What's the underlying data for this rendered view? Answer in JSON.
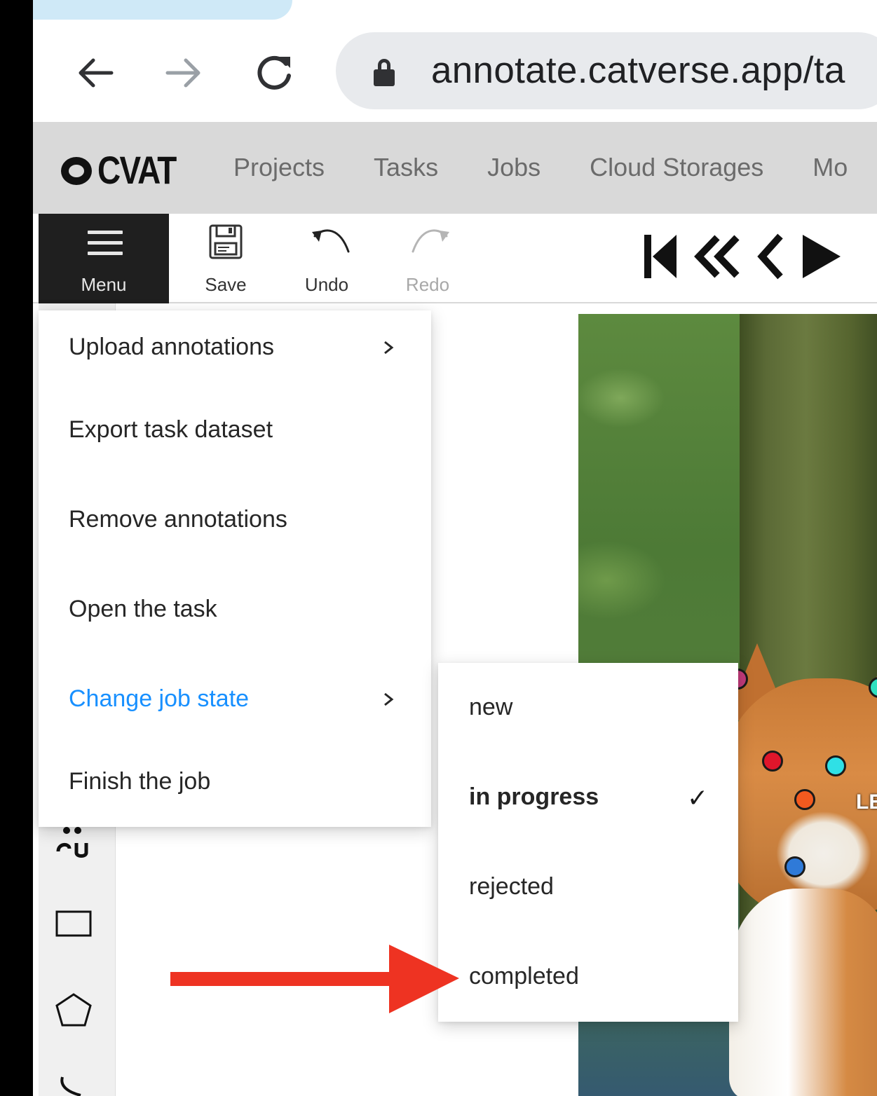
{
  "browser": {
    "back_icon": "arrow-left-icon",
    "forward_icon": "arrow-right-icon",
    "reload_icon": "reload-icon",
    "lock_icon": "lock-icon",
    "url": "annotate.catverse.app/ta"
  },
  "app_header": {
    "logo_text": "CVAT",
    "nav": [
      "Projects",
      "Tasks",
      "Jobs",
      "Cloud Storages",
      "Mo"
    ]
  },
  "toolbar": {
    "menu_label": "Menu",
    "save_label": "Save",
    "undo_label": "Undo",
    "redo_label": "Redo",
    "player_icons": [
      "first-frame-icon",
      "fast-backward-icon",
      "previous-icon",
      "play-icon"
    ]
  },
  "main_menu": {
    "items": [
      {
        "label": "Upload annotations",
        "has_submenu": true
      },
      {
        "label": "Export task dataset",
        "has_submenu": false
      },
      {
        "label": "Remove annotations",
        "has_submenu": false
      },
      {
        "label": "Open the task",
        "has_submenu": false
      },
      {
        "label": "Change job state",
        "has_submenu": true,
        "active": true
      },
      {
        "label": "Finish the job",
        "has_submenu": false
      }
    ]
  },
  "job_state_menu": {
    "items": [
      {
        "label": "new"
      },
      {
        "label": "in progress",
        "selected": true
      },
      {
        "label": "rejected"
      },
      {
        "label": "completed"
      }
    ],
    "check_mark": "✓"
  },
  "canvas": {
    "image_label": "LE"
  },
  "sidebar": {
    "icons": [
      "points-icon",
      "rectangle-icon",
      "polygon-icon",
      "polyline-icon"
    ]
  },
  "colors": {
    "active_menu": "#1890ff",
    "annotation_arrow": "#ee3322",
    "menu_button_bg": "#1f1f1f",
    "header_bg": "#d9d9d9"
  }
}
